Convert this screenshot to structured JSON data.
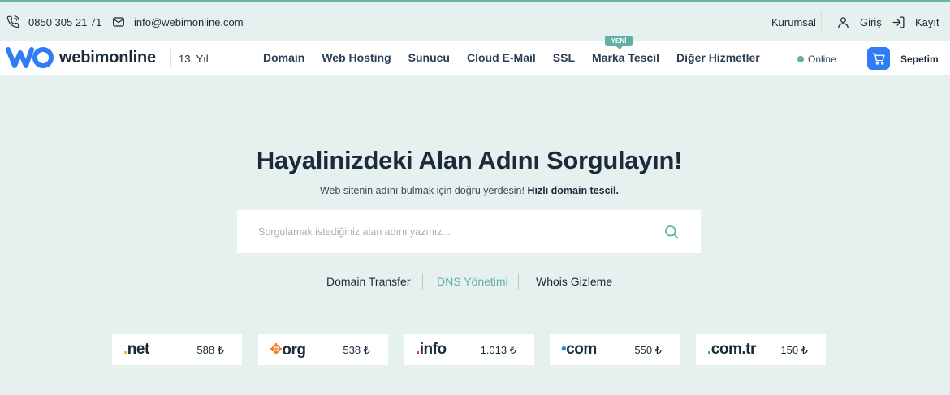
{
  "topbar": {
    "phone": "0850 305 21 71",
    "email": "info@webimonline.com",
    "corporate": "Kurumsal",
    "login": "Giriş",
    "register": "Kayıt"
  },
  "nav": {
    "logo_text": "webimonline",
    "years": "13. Yıl",
    "menu": [
      "Domain",
      "Web Hosting",
      "Sunucu",
      "Cloud E-Mail",
      "SSL",
      "Marka Tescil",
      "Diğer Hizmetler"
    ],
    "new_badge": "YENİ",
    "online": "Online",
    "cart": "Sepetim"
  },
  "hero": {
    "title": "Hayalinizdeki Alan Adını Sorgulayın!",
    "subtitle_normal": "Web sitenin adını bulmak için doğru yerdesin!",
    "subtitle_bold": "Hızlı domain tescil."
  },
  "search": {
    "placeholder": "Sorgulamak istediğiniz alan adını yazınız..."
  },
  "quicklinks": [
    "Domain Transfer",
    "DNS Yönetimi",
    "Whois Gizleme"
  ],
  "tlds": [
    {
      "label": "net",
      "price": "588 ₺"
    },
    {
      "label": "org",
      "price": "538 ₺"
    },
    {
      "label": "info",
      "price": "1.013 ₺"
    },
    {
      "label": "com",
      "price": "550 ₺"
    },
    {
      "label": "com.tr",
      "price": "150 ₺"
    }
  ],
  "colors": {
    "accent": "#5fb0a3",
    "cart_button": "#2f7cf6",
    "background": "#e6f0ee"
  }
}
